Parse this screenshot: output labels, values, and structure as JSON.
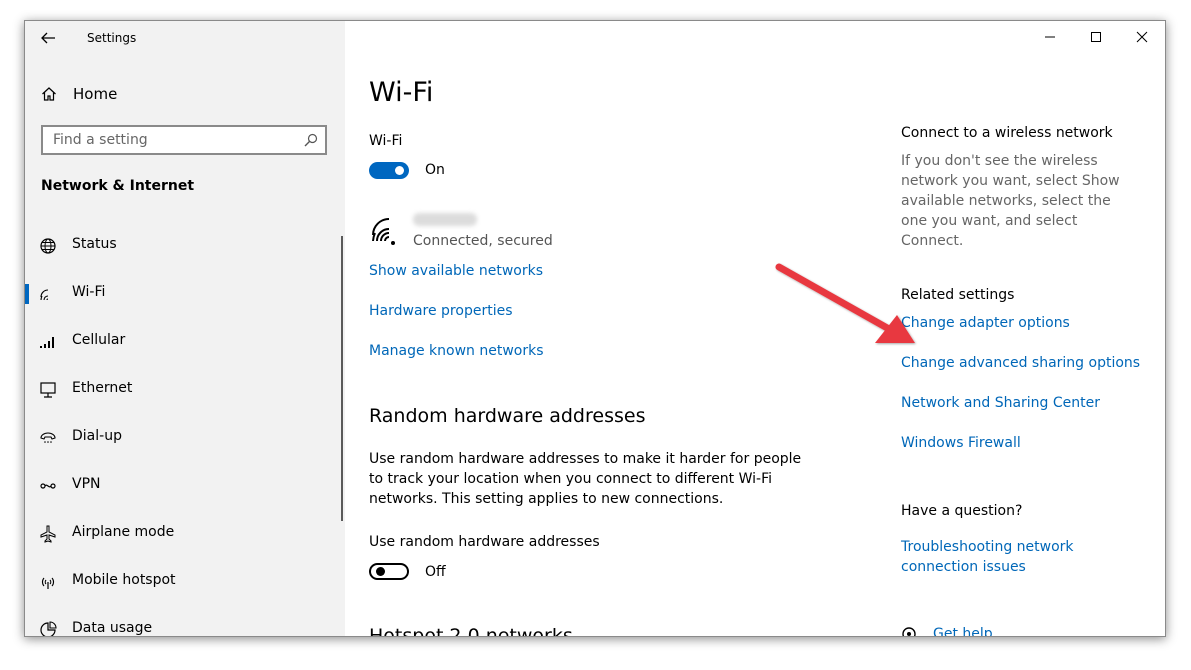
{
  "window": {
    "title": "Settings"
  },
  "colors": {
    "accent": "#0067c0",
    "link": "#0067b8",
    "annotation_arrow": "#e8393f"
  },
  "sidebar": {
    "home_label": "Home",
    "search_placeholder": "Find a setting",
    "section_title": "Network & Internet",
    "items": [
      {
        "label": "Status",
        "icon": "globe-icon",
        "active": false
      },
      {
        "label": "Wi-Fi",
        "icon": "wifi-icon",
        "active": true
      },
      {
        "label": "Cellular",
        "icon": "cellular-icon",
        "active": false
      },
      {
        "label": "Ethernet",
        "icon": "ethernet-icon",
        "active": false
      },
      {
        "label": "Dial-up",
        "icon": "dialup-icon",
        "active": false
      },
      {
        "label": "VPN",
        "icon": "vpn-icon",
        "active": false
      },
      {
        "label": "Airplane mode",
        "icon": "airplane-icon",
        "active": false
      },
      {
        "label": "Mobile hotspot",
        "icon": "hotspot-icon",
        "active": false
      },
      {
        "label": "Data usage",
        "icon": "data-usage-icon",
        "active": false
      }
    ]
  },
  "main": {
    "title": "Wi-Fi",
    "wifi_label": "Wi-Fi",
    "wifi_toggle": {
      "state": "On",
      "on": true
    },
    "network": {
      "status": "Connected, secured"
    },
    "links": [
      "Show available networks",
      "Hardware properties",
      "Manage known networks"
    ],
    "random_hw": {
      "heading": "Random hardware addresses",
      "description": "Use random hardware addresses to make it harder for people to track your location when you connect to different Wi-Fi networks. This setting applies to new connections.",
      "toggle_label": "Use random hardware addresses",
      "toggle_state": "Off",
      "on": false
    },
    "hotspot_heading": "Hotspot 2.0 networks"
  },
  "right": {
    "connect_heading": "Connect to a wireless network",
    "connect_description": "If you don't see the wireless network you want, select Show available networks, select the one you want, and select Connect.",
    "related_heading": "Related settings",
    "related_links": [
      "Change adapter options",
      "Change advanced sharing options",
      "Network and Sharing Center",
      "Windows Firewall"
    ],
    "question_heading": "Have a question?",
    "question_link": "Troubleshooting network connection issues",
    "get_help": "Get help"
  }
}
